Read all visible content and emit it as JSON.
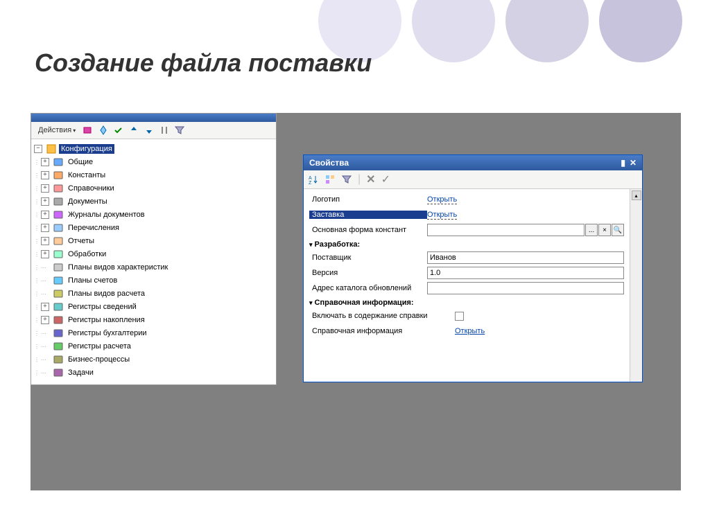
{
  "slide": {
    "title": "Создание файла поставки"
  },
  "leftPanel": {
    "actions": "Действия",
    "rootLabel": "Конфигурация",
    "items": [
      {
        "label": "Общие",
        "expandable": true
      },
      {
        "label": "Константы",
        "expandable": true
      },
      {
        "label": "Справочники",
        "expandable": true
      },
      {
        "label": "Документы",
        "expandable": true
      },
      {
        "label": "Журналы документов",
        "expandable": true
      },
      {
        "label": "Перечисления",
        "expandable": true
      },
      {
        "label": "Отчеты",
        "expandable": true
      },
      {
        "label": "Обработки",
        "expandable": true
      },
      {
        "label": "Планы видов характеристик",
        "expandable": false
      },
      {
        "label": "Планы счетов",
        "expandable": false
      },
      {
        "label": "Планы видов расчета",
        "expandable": false
      },
      {
        "label": "Регистры сведений",
        "expandable": true
      },
      {
        "label": "Регистры накопления",
        "expandable": true
      },
      {
        "label": "Регистры бухгалтерии",
        "expandable": false
      },
      {
        "label": "Регистры расчета",
        "expandable": false
      },
      {
        "label": "Бизнес-процессы",
        "expandable": false
      },
      {
        "label": "Задачи",
        "expandable": false
      }
    ]
  },
  "propsPanel": {
    "title": "Свойства",
    "rows": {
      "logo": {
        "label": "Логотип",
        "action": "Открыть"
      },
      "splash": {
        "label": "Заставка",
        "action": "Открыть"
      },
      "mainForm": {
        "label": "Основная форма констант"
      }
    },
    "group1": "Разработка:",
    "vendor": {
      "label": "Поставщик",
      "value": "Иванов"
    },
    "version": {
      "label": "Версия",
      "value": "1.0"
    },
    "catalog": {
      "label": "Адрес каталога обновлений",
      "value": ""
    },
    "group2": "Справочная информация:",
    "includeHelp": {
      "label": "Включать в содержание справки"
    },
    "helpInfo": {
      "label": "Справочная информация",
      "action": "Открыть"
    }
  }
}
